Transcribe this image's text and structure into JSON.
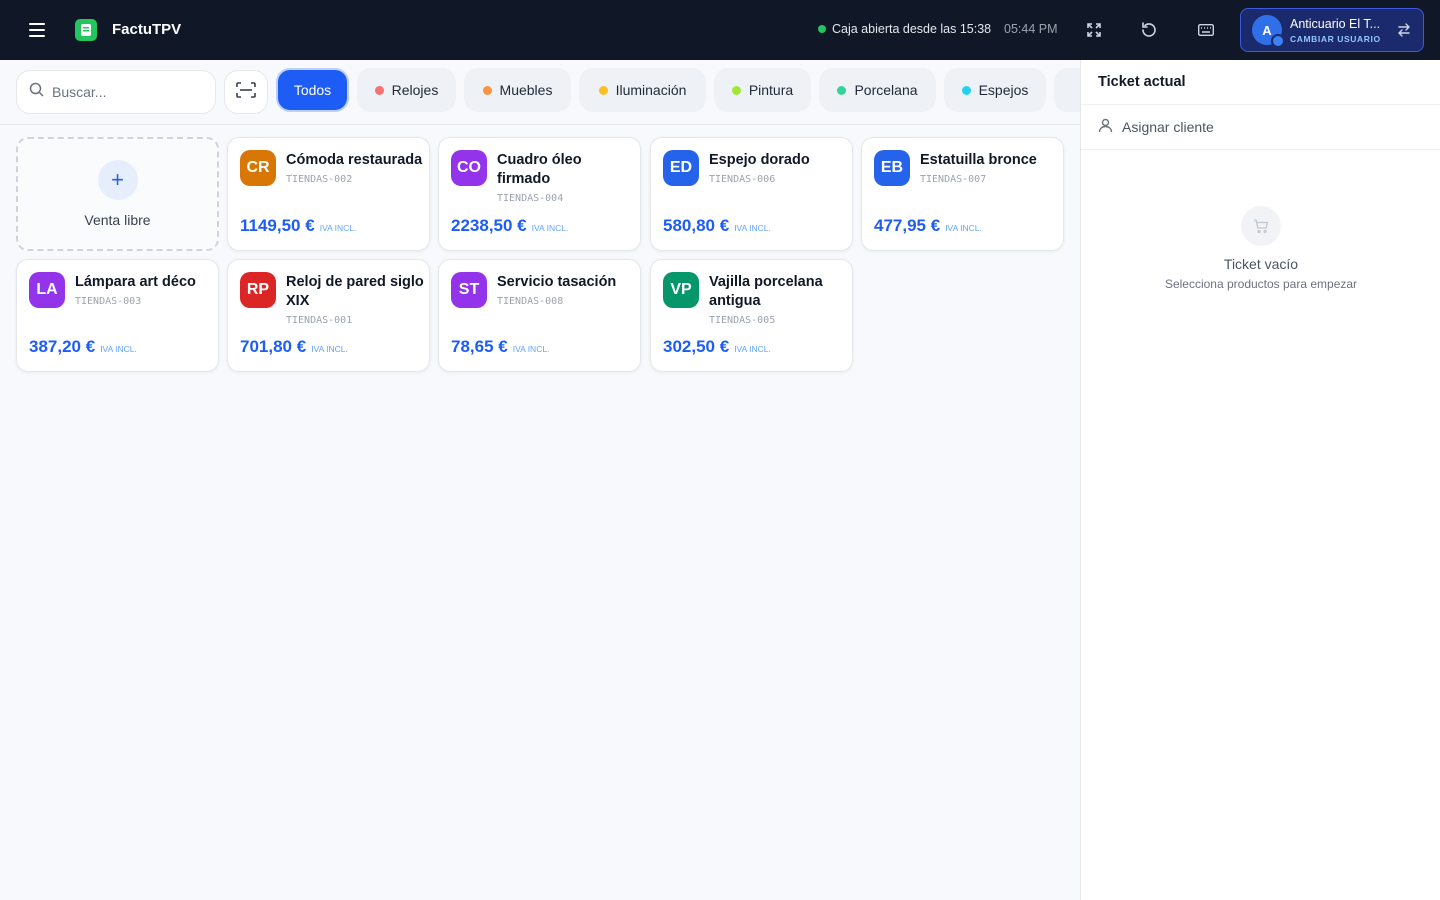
{
  "header": {
    "brand": "FactuTPV",
    "status_text": "Caja abierta desde las 15:38",
    "time": "05:44 PM",
    "user": {
      "initial": "A",
      "name": "Anticuario El T...",
      "action": "CAMBIAR USUARIO"
    }
  },
  "toolbar": {
    "search_placeholder": "Buscar...",
    "categories": [
      {
        "label": "Todos",
        "active": true
      },
      {
        "label": "Relojes",
        "color": "#f87171"
      },
      {
        "label": "Muebles",
        "color": "#fb923c"
      },
      {
        "label": "Iluminación",
        "color": "#fbbf24"
      },
      {
        "label": "Pintura",
        "color": "#a3e635"
      },
      {
        "label": "Porcelana",
        "color": "#34d399"
      },
      {
        "label": "Espejos",
        "color": "#22d3ee"
      }
    ]
  },
  "grid": {
    "free_sale": {
      "label": "Venta libre"
    },
    "products": [
      {
        "initials": "CR",
        "color": "#d97706",
        "name": "Cómoda restaurada",
        "sku": "TIENDAS-002",
        "price": "1149,50 €",
        "tax": "IVA INCL."
      },
      {
        "initials": "CO",
        "color": "#9333ea",
        "name": "Cuadro óleo firmado",
        "sku": "TIENDAS-004",
        "price": "2238,50 €",
        "tax": "IVA INCL."
      },
      {
        "initials": "ED",
        "color": "#2563eb",
        "name": "Espejo dorado",
        "sku": "TIENDAS-006",
        "price": "580,80 €",
        "tax": "IVA INCL."
      },
      {
        "initials": "EB",
        "color": "#2563eb",
        "name": "Estatuilla bronce",
        "sku": "TIENDAS-007",
        "price": "477,95 €",
        "tax": "IVA INCL."
      },
      {
        "initials": "LA",
        "color": "#9333ea",
        "name": "Lámpara art déco",
        "sku": "TIENDAS-003",
        "price": "387,20 €",
        "tax": "IVA INCL."
      },
      {
        "initials": "RP",
        "color": "#dc2626",
        "name": "Reloj de pared siglo XIX",
        "sku": "TIENDAS-001",
        "price": "701,80 €",
        "tax": "IVA INCL."
      },
      {
        "initials": "ST",
        "color": "#9333ea",
        "name": "Servicio tasación",
        "sku": "TIENDAS-008",
        "price": "78,65 €",
        "tax": "IVA INCL."
      },
      {
        "initials": "VP",
        "color": "#059669",
        "name": "Vajilla porcelana antigua",
        "sku": "TIENDAS-005",
        "price": "302,50 €",
        "tax": "IVA INCL."
      }
    ]
  },
  "ticket": {
    "title": "Ticket actual",
    "assign_client": "Asignar cliente",
    "empty_title": "Ticket vacío",
    "empty_subtitle": "Selecciona productos para empezar"
  }
}
